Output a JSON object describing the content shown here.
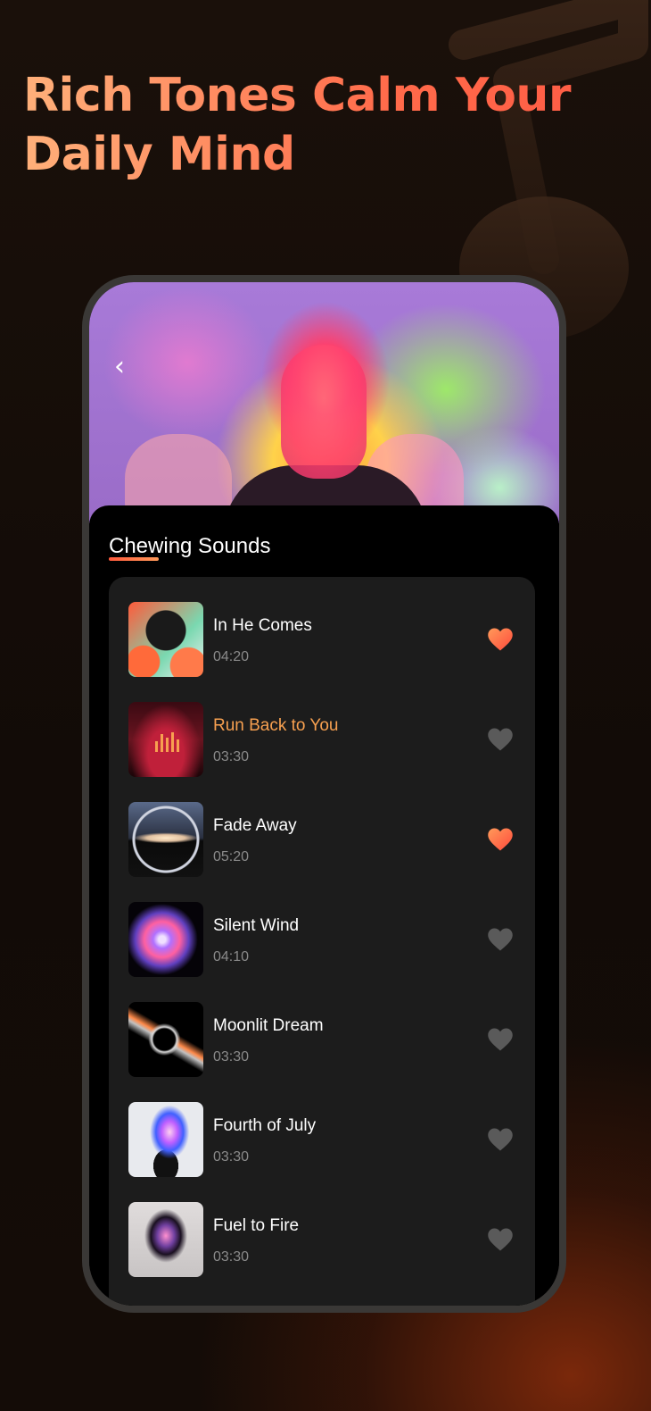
{
  "headline": {
    "line1": "Rich Tones Calm Your",
    "line2": "Daily Mind"
  },
  "colors": {
    "accent": "#ff6a4a",
    "active_track": "#f7a050",
    "heart_on": "#ff6a4a",
    "heart_off": "#5a5a5a"
  },
  "section_title": "Chewing Sounds",
  "tracks": [
    {
      "title": "In He Comes",
      "duration": "04:20",
      "liked": true,
      "playing": false
    },
    {
      "title": "Run Back to You",
      "duration": "03:30",
      "liked": false,
      "playing": true
    },
    {
      "title": "Fade Away",
      "duration": "05:20",
      "liked": true,
      "playing": false
    },
    {
      "title": "Silent Wind",
      "duration": "04:10",
      "liked": false,
      "playing": false
    },
    {
      "title": "Moonlit Dream",
      "duration": "03:30",
      "liked": false,
      "playing": false
    },
    {
      "title": "Fourth of July",
      "duration": "03:30",
      "liked": false,
      "playing": false
    },
    {
      "title": "Fuel to Fire",
      "duration": "03:30",
      "liked": false,
      "playing": false
    }
  ]
}
